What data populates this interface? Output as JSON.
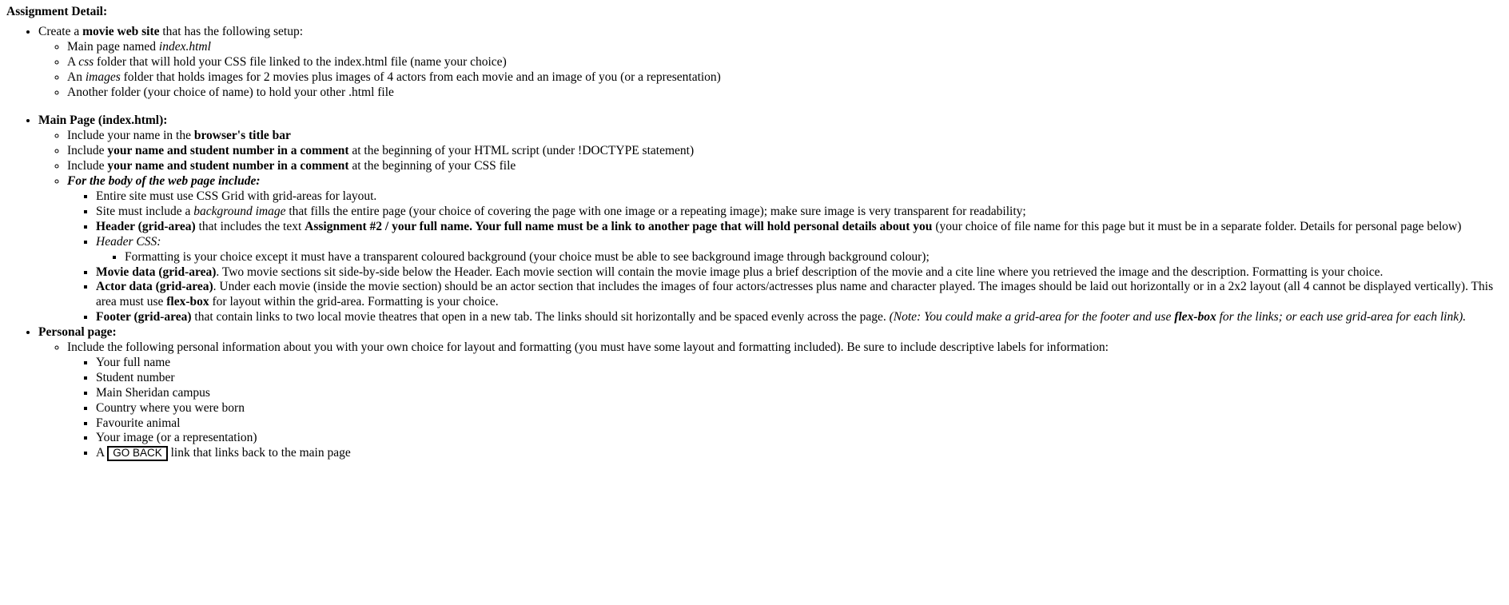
{
  "document": {
    "title": "Assignment Detail:",
    "sections": [
      {
        "id": "site-setup",
        "heading_plain": "Create a ",
        "heading_bold": "movie web site",
        "heading_tail": " that has the following setup:",
        "items": [
          {
            "pre": "Main page named ",
            "em": "index.html",
            "post": ""
          },
          {
            "pre": "A ",
            "em": "css",
            "post": " folder that will hold your CSS file linked to the index.html file (name your choice)"
          },
          {
            "pre": "An ",
            "em": "images",
            "post": " folder that holds images for 2 movies plus images of 4 actors from each movie and an image of you (or a representation)"
          },
          {
            "pre": "Another folder (your choice of name) to hold your other .html file",
            "em": "",
            "post": ""
          }
        ]
      }
    ],
    "main_page": {
      "heading": "Main Page (index.html):",
      "item1_pre": "Include your name in the ",
      "item1_bold": "browser's title bar",
      "item1_post": "",
      "item2_pre": "Include ",
      "item2_bold": "your name and student number in a comment",
      "item2_post": " at the beginning of your HTML script (under !DOCTYPE statement)",
      "item3_pre": "Include ",
      "item3_bold": "your name and student number in a comment",
      "item3_post": " at the beginning of your CSS file",
      "body_heading": "For the body of the web page include:",
      "body_items": {
        "grid": "Entire site must use CSS Grid with grid-areas for layout.",
        "background_pre": "Site must include a ",
        "background_em": "background image",
        "background_post": " that fills the entire page (your choice of covering the page with one image or a repeating image); make sure image is very transparent for readability;",
        "header_bold1": "Header (grid-area)",
        "header_mid1": " that includes the text ",
        "header_bold2": "Assignment #2 / your full name. Your full name must be a link to another page that will hold personal details about you",
        "header_tail": " (your choice of file name for this page but it must be in a separate folder. Details for personal page below)",
        "header_css_label": "Header CSS:",
        "header_css_detail": "Formatting is your choice except it must have a transparent coloured background (your choice must be able to see background image through background colour);",
        "movie_bold": "Movie data (grid-area)",
        "movie_text": ". Two movie sections sit side-by-side below the Header. Each movie section will contain the movie image plus a brief description of the movie and a cite line where you retrieved the image and the description. Formatting is your choice.",
        "actor_bold": "Actor data (grid-area)",
        "actor_text1": ". Under each movie (inside the movie section) should be an actor section that includes the images of four actors/actresses plus name and character played. The images should be laid out horizontally or in a 2x2 layout (all 4 cannot be displayed vertically). This area must use ",
        "actor_bold2": "flex-box",
        "actor_text2": " for layout within the grid-area. Formatting is your choice.",
        "footer_bold": "Footer (grid-area)",
        "footer_text": " that contain links to two local movie theatres that open in a new tab. The links should sit horizontally and be spaced evenly across the page. ",
        "footer_note_pre": "(Note: You could make a grid-area for the footer and use ",
        "footer_note_bold": "flex-box",
        "footer_note_post": " for the links; or each use grid-area for each link)."
      }
    },
    "personal_page": {
      "heading": "Personal page:",
      "intro": "Include the following personal information about you with your own choice for layout and formatting (you must have some layout and formatting included). Be sure to include descriptive labels for information:",
      "items": [
        "Your full name",
        "Student number",
        "Main Sheridan campus",
        "Country where you were born",
        "Favourite animal",
        "Your image (or a representation)"
      ],
      "goback_pre": "A ",
      "goback_label": "GO BACK",
      "goback_post": " link that links back to the main page"
    }
  }
}
